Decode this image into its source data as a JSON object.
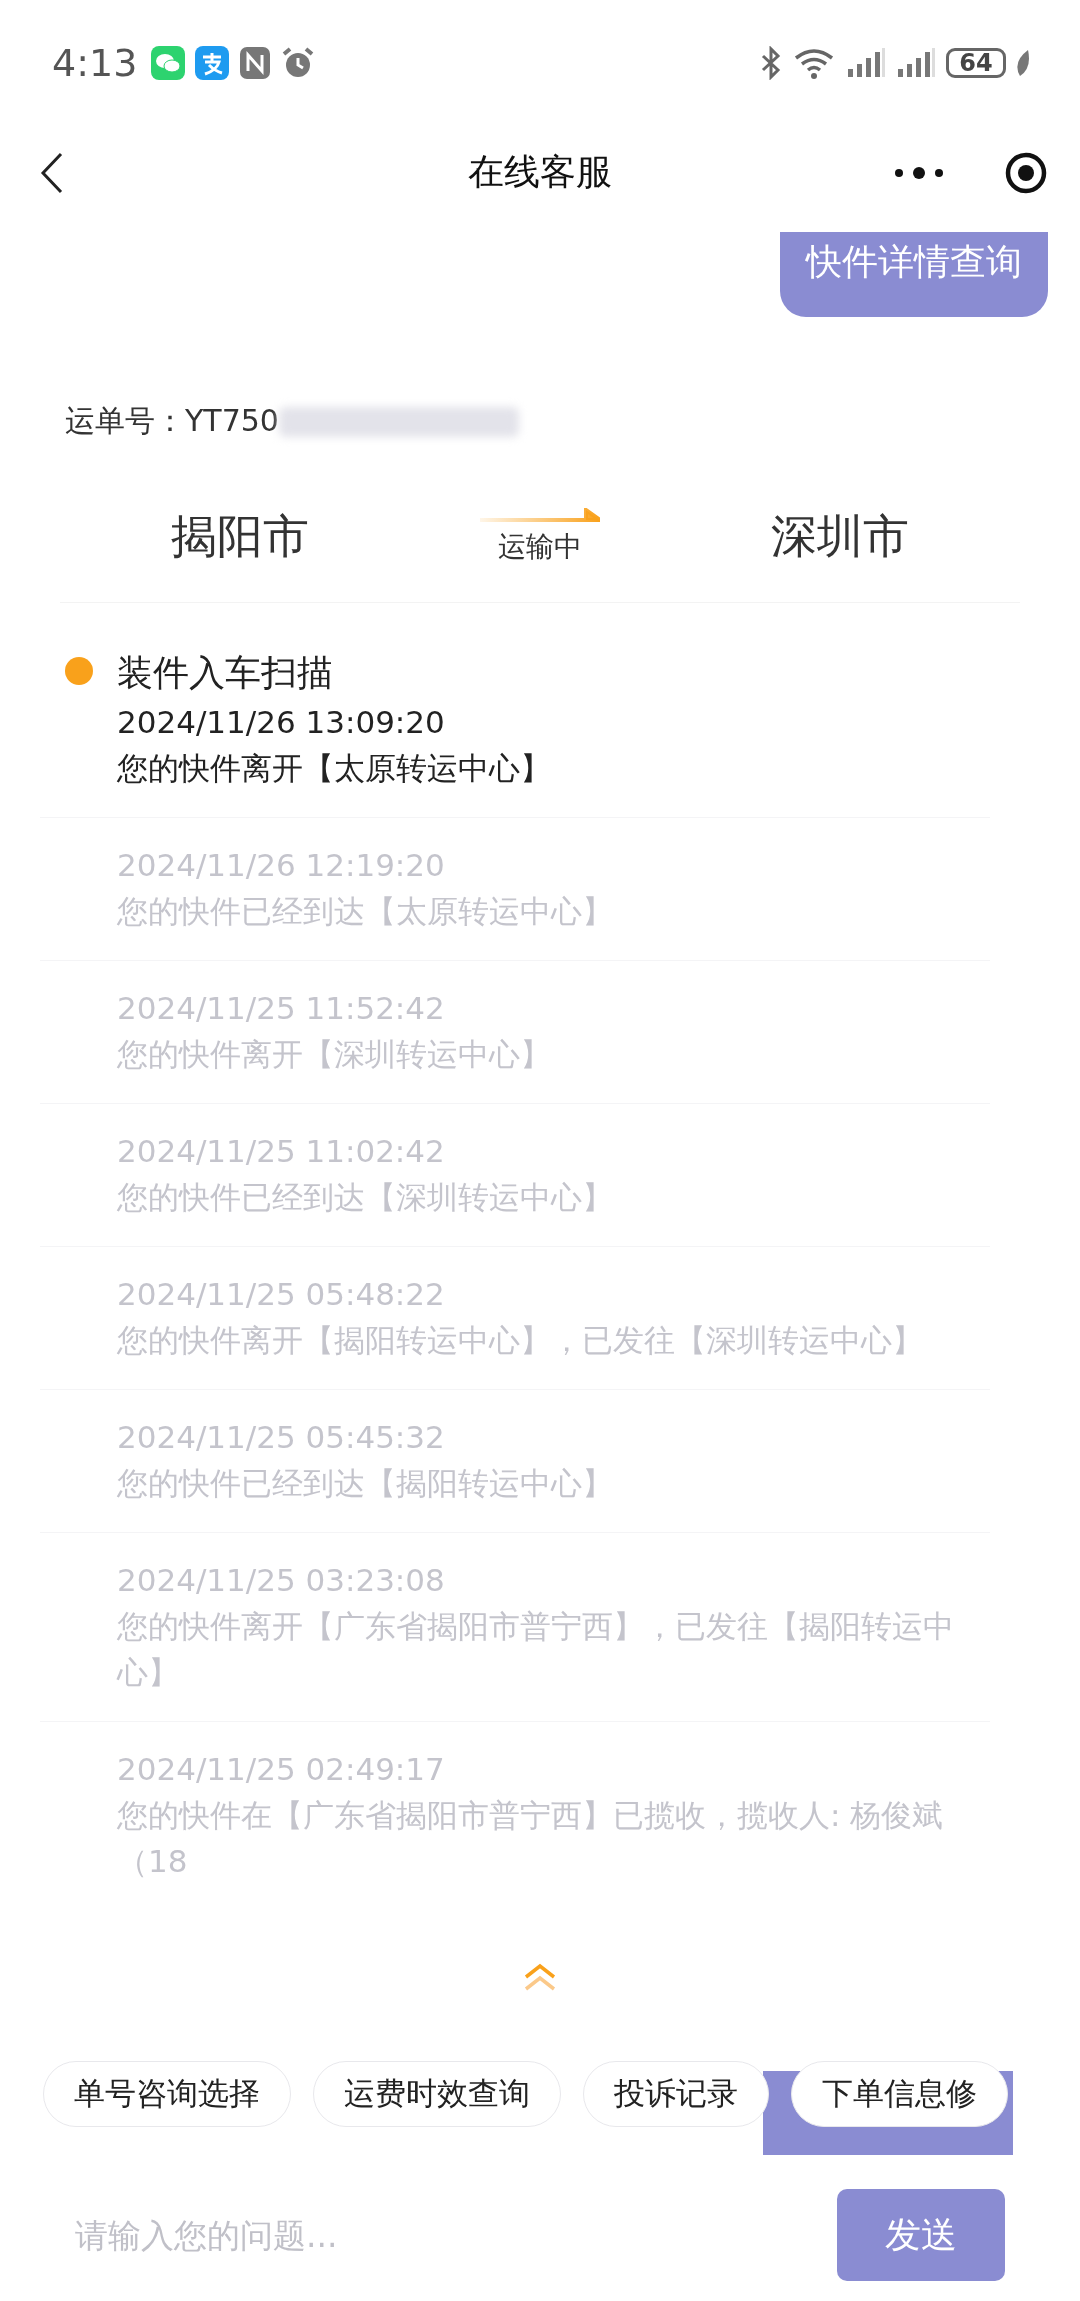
{
  "status_bar": {
    "time": "4:13",
    "battery": "64"
  },
  "header": {
    "title": "在线客服"
  },
  "sent_bubble": {
    "text": "快件详情查询"
  },
  "waybill": {
    "label": "运单号：YT750"
  },
  "route": {
    "from": "揭阳市",
    "status": "运输中",
    "to": "深圳市"
  },
  "timeline": [
    {
      "title": "装件入车扫描",
      "time": "2024/11/26 13:09:20",
      "text": "您的快件离开【太原转运中心】",
      "current": true
    },
    {
      "time": "2024/11/26 12:19:20",
      "text": "您的快件已经到达【太原转运中心】",
      "current": false
    },
    {
      "time": "2024/11/25 11:52:42",
      "text": "您的快件离开【深圳转运中心】",
      "current": false
    },
    {
      "time": "2024/11/25 11:02:42",
      "text": "您的快件已经到达【深圳转运中心】",
      "current": false
    },
    {
      "time": "2024/11/25 05:48:22",
      "text": "您的快件离开【揭阳转运中心】，已发往【深圳转运中心】",
      "current": false
    },
    {
      "time": "2024/11/25 05:45:32",
      "text": "您的快件已经到达【揭阳转运中心】",
      "current": false
    },
    {
      "time": "2024/11/25 03:23:08",
      "text": "您的快件离开【广东省揭阳市普宁西】，已发往【揭阳转运中心】",
      "current": false
    },
    {
      "time": "2024/11/25 02:49:17",
      "text": "您的快件在【广东省揭阳市普宁西】已揽收，揽收人: 杨俊斌（18",
      "current": false
    }
  ],
  "hidden_bubble": {
    "kind": "bubble"
  },
  "quick_replies": [
    "单号咨询选择",
    "运费时效查询",
    "投诉记录",
    "下单信息修"
  ],
  "input": {
    "placeholder": "请输入您的问题..."
  },
  "send_button": {
    "label": "发送"
  }
}
